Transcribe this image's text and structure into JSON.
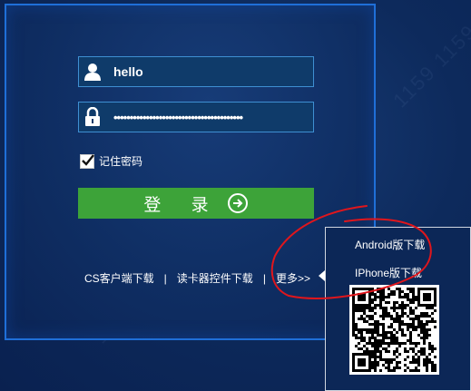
{
  "login": {
    "username_value": "hello",
    "password_value": "••••••••••••••••••••••••••••••••••••••••",
    "remember_label": "记住密码",
    "remember_checked": true,
    "login_button_label": "登 录"
  },
  "downloads": {
    "cs_client": "CS客户端下载",
    "separator": "|",
    "card_reader": "读卡器控件下载",
    "more": "更多>>"
  },
  "popup": {
    "android": "Android版下载",
    "iphone": "IPhone版下载"
  },
  "colors": {
    "background": "#0c2757",
    "panel_border": "#1f6fd8",
    "field_border": "#3e8fd2",
    "login_button": "#3da339",
    "annotation": "#e0161c"
  },
  "icons": {
    "username": "user-icon",
    "password": "lock-icon",
    "login_arrow": "arrow-circle-right-icon",
    "popup_pointer": "triangle-left-icon",
    "qr": "qr-code"
  }
}
